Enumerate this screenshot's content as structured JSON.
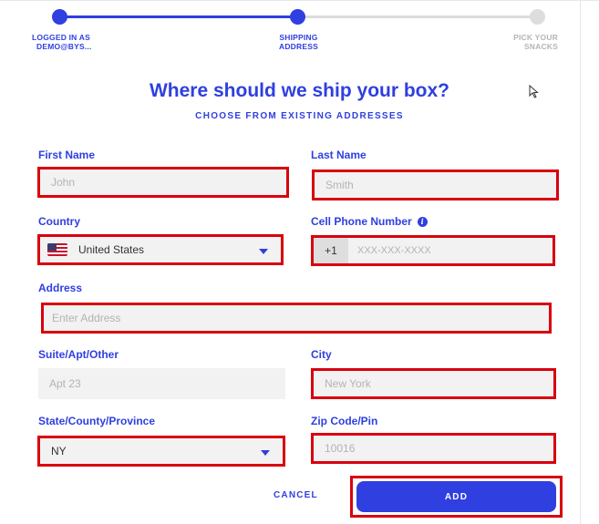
{
  "progress": {
    "steps": [
      {
        "label_line1": "LOGGED IN AS",
        "label_line2": "DEMO@BYS..."
      },
      {
        "label_line1": "SHIPPING",
        "label_line2": "ADDRESS"
      },
      {
        "label_line1": "PICK YOUR",
        "label_line2": "SNACKS"
      }
    ],
    "current_step": 2,
    "filled_fraction": 0.5
  },
  "header": {
    "title": "Where should we ship your box?",
    "link": "CHOOSE FROM EXISTING ADDRESSES"
  },
  "form": {
    "first_name": {
      "label": "First Name",
      "placeholder": "John"
    },
    "last_name": {
      "label": "Last Name",
      "placeholder": "Smith"
    },
    "country": {
      "label": "Country",
      "value": "United States"
    },
    "phone": {
      "label": "Cell Phone Number",
      "prefix": "+1",
      "placeholder": "XXX-XXX-XXXX"
    },
    "address": {
      "label": "Address",
      "placeholder": "Enter Address"
    },
    "suite": {
      "label": "Suite/Apt/Other",
      "placeholder": "Apt 23"
    },
    "city": {
      "label": "City",
      "placeholder": "New York"
    },
    "state": {
      "label": "State/County/Province",
      "value": "NY"
    },
    "zip": {
      "label": "Zip Code/Pin",
      "placeholder": "10016"
    }
  },
  "actions": {
    "cancel": "CANCEL",
    "add": "ADD"
  },
  "colors": {
    "accent": "#2f3fe0",
    "highlight": "#d9000e",
    "field_bg": "#f2f2f2"
  },
  "icons": {
    "info": "info-icon",
    "flag": "us-flag-icon",
    "dropdown": "chevron-down-icon"
  }
}
